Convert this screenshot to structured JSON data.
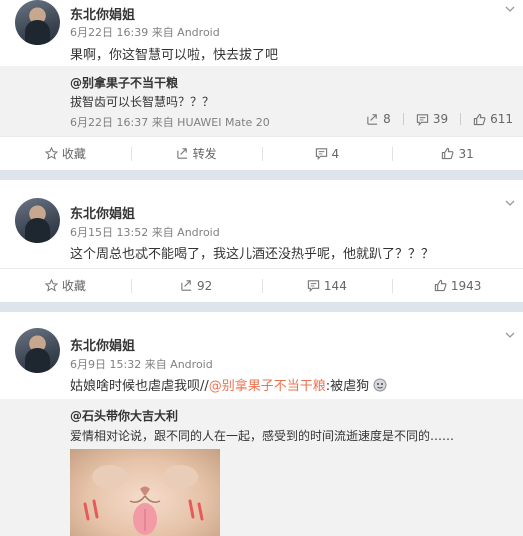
{
  "comments": [
    {
      "user": "东北你娟姐",
      "meta": "6月22日 16:39 来自 Android",
      "text": "果啊，你这智慧可以啦，快去拔了吧",
      "quote": {
        "user": "@别拿果子不当干粮",
        "text": "拔智齿可以长智慧吗？？？",
        "meta": "6月22日 16:37 来自 HUAWEI Mate 20",
        "reposts": "8",
        "comments": "39",
        "likes": "611"
      },
      "actions": {
        "favorite": "收藏",
        "repost": "转发",
        "comment": "4",
        "like": "31"
      }
    },
    {
      "user": "东北你娟姐",
      "meta": "6月15日 13:52 来自 Android",
      "text": "这个周总也忒不能喝了，我这儿酒还没热乎呢，他就趴了？？？",
      "actions": {
        "favorite": "收藏",
        "repost": "92",
        "comment": "144",
        "like": "1943"
      }
    },
    {
      "user": "东北你娟姐",
      "meta": "6月9日 15:32 来自 Android",
      "text_pre": "姑娘啥时候也虐虐我呗//",
      "text_mention": "@别拿果子不当干粮",
      "text_post": ":被虐狗",
      "quote": {
        "user": "@石头带你大吉大利",
        "text": "爱情相对论说，跟不同的人在一起，感受到的时间流逝速度是不同的……"
      }
    }
  ],
  "icons": {
    "chevron": "chevron-down-icon",
    "star": "star-icon",
    "repost": "repost-icon",
    "comment": "comment-icon",
    "like": "like-icon"
  },
  "colors": {
    "mention": "#eb7350",
    "separator": "#dde4ec",
    "quote_bg": "#f2f2f2"
  }
}
